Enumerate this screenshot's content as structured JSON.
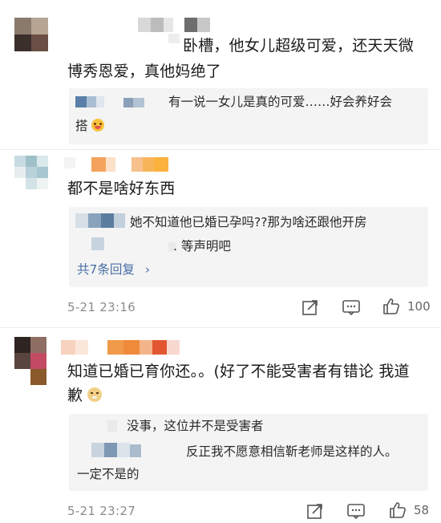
{
  "comments": [
    {
      "text_line1": "卧槽，他女儿超级可爱，还天天微",
      "text_line2": "博秀恩爱，真他妈绝了",
      "reply": {
        "line1": "有一说一女儿是真的可爱……好会养好会",
        "line2": "搭"
      },
      "emoji": "smile-emoji"
    },
    {
      "text": "都不是啥好东西",
      "reply": {
        "line1": "她不知道他已婚已孕吗??那为啥还跟他开房",
        "line2": ". 等声明吧"
      },
      "more_replies": "共7条回复",
      "timestamp": "5-21 23:16",
      "like_count": "100"
    },
    {
      "text_line1": "知道已婚已育你还。。(好了不能受害者有错论 我道",
      "text_line2": "歉",
      "reply": {
        "line1": "没事，这位并不是受害者",
        "line2": "反正我不愿意相信靳老师是这样的人。",
        "line3": "一定不是的"
      },
      "emoji": "doge-emoji",
      "timestamp": "5-21 23:27",
      "like_count": "58"
    }
  ],
  "icons": {
    "share": "share-icon",
    "comment": "comment-icon",
    "like": "thumbs-up-icon"
  },
  "colors": {
    "link": "#4a6fa5",
    "reply_bg": "#f4f4f4",
    "meta": "#8c8c8c"
  }
}
